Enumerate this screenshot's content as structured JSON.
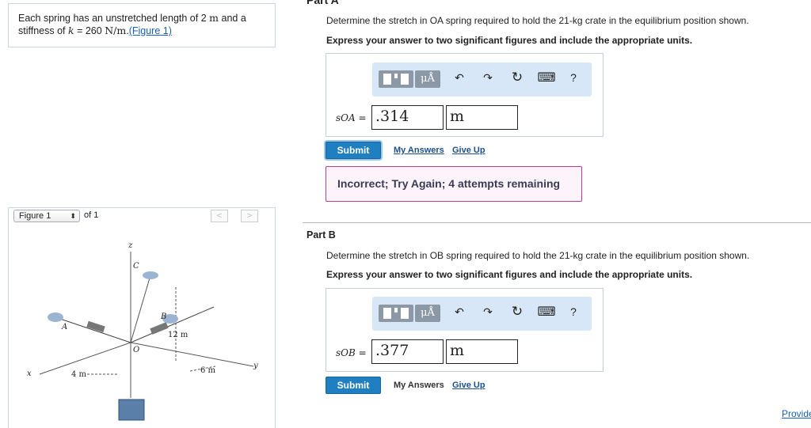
{
  "problem": {
    "intro": "Each spring has an unstretched length of 2",
    "unit_m": "m",
    "and_a": "and a",
    "stiffness_prefix": "stiffness of",
    "k_var": "k",
    "equals": "= 260",
    "k_unit": "N/m",
    "period": ".",
    "figure_link": "(Figure 1)"
  },
  "figure_nav": {
    "select_label": "Figure 1",
    "of_label": "of 1",
    "prev": "<",
    "next": ">"
  },
  "figure": {
    "labels": {
      "z": "z",
      "C": "C",
      "B": "B",
      "A": "A",
      "O": "O",
      "x": "x",
      "y": "y",
      "dim_12": "12 m",
      "dim_4": "4 m",
      "dim_6": "6 m"
    }
  },
  "part_a": {
    "title": "Part A",
    "question": "Determine the stretch in OA spring required to hold the 21-kg crate in the equilibrium position shown.",
    "instruction": "Express your answer to two significant figures and include the appropriate units.",
    "var_label": "sOA =",
    "value": ".314",
    "unit": "m",
    "submit": "Submit",
    "my_answers": "My Answers",
    "give_up": "Give Up",
    "feedback": "Incorrect; Try Again; 4 attempts remaining"
  },
  "part_b": {
    "title": "Part B",
    "question": "Determine the stretch in OB spring required to hold the 21-kg crate in the equilibrium position shown.",
    "instruction": "Express your answer to two significant figures and include the appropriate units.",
    "var_label": "sOB =",
    "value": ".377",
    "unit": "m",
    "submit": "Submit",
    "my_answers": "My Answers",
    "give_up": "Give Up"
  },
  "toolbar": {
    "mu_label": "μÅ",
    "undo": "↶",
    "redo": "↷",
    "reset": "↻",
    "keyboard": "⌨",
    "help": "?"
  },
  "footer": {
    "provide": "Provide"
  },
  "colors": {
    "accent": "#1f7fc1",
    "toolbar_bg": "#d8e7f7",
    "feedback_border": "#c23a8a"
  }
}
